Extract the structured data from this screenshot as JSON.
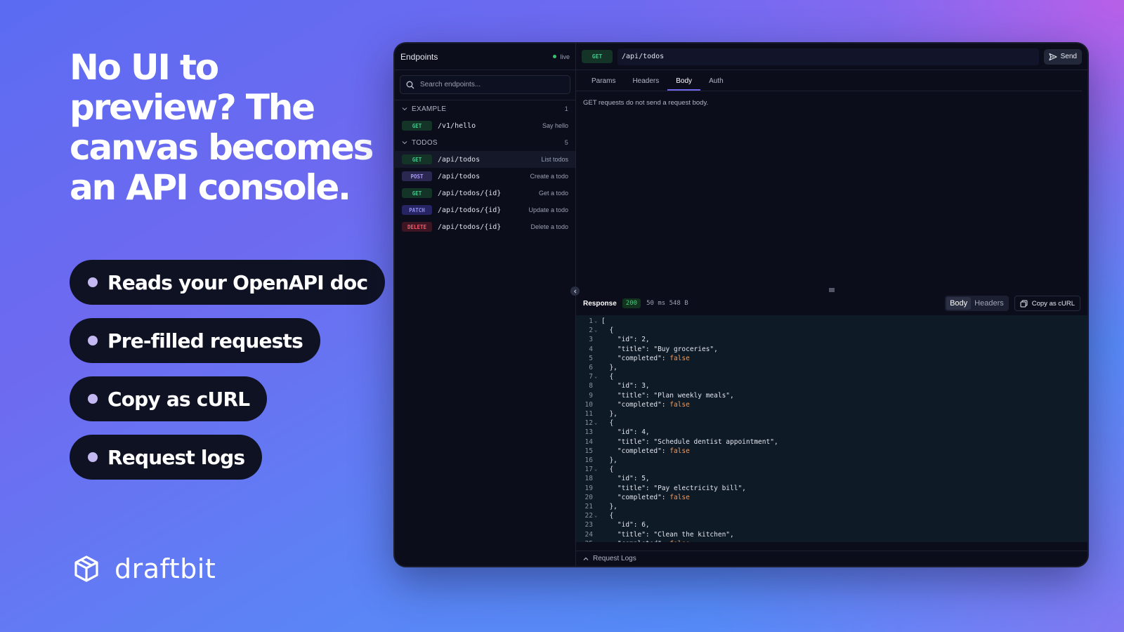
{
  "promo": {
    "headline": "No UI to preview? The canvas becomes an API console.",
    "features": [
      "Reads your OpenAPI doc",
      "Pre-filled requests",
      "Copy as cURL",
      "Request logs"
    ],
    "brand": "draftbit"
  },
  "sidebar": {
    "title": "Endpoints",
    "status": "live",
    "search_placeholder": "Search endpoints...",
    "groups": [
      {
        "name": "EXAMPLE",
        "count": "1",
        "endpoints": [
          {
            "method": "GET",
            "path": "/v1/hello",
            "desc": "Say hello"
          }
        ]
      },
      {
        "name": "TODOS",
        "count": "5",
        "endpoints": [
          {
            "method": "GET",
            "path": "/api/todos",
            "desc": "List todos"
          },
          {
            "method": "POST",
            "path": "/api/todos",
            "desc": "Create a todo"
          },
          {
            "method": "GET",
            "path": "/api/todos/{id}",
            "desc": "Get a todo"
          },
          {
            "method": "PATCH",
            "path": "/api/todos/{id}",
            "desc": "Update a todo"
          },
          {
            "method": "DELETE",
            "path": "/api/todos/{id}",
            "desc": "Delete a todo"
          }
        ]
      }
    ]
  },
  "request": {
    "method": "GET",
    "url": "/api/todos",
    "send_label": "Send",
    "tabs": [
      "Params",
      "Headers",
      "Body",
      "Auth"
    ],
    "active_tab": "Body",
    "body_note": "GET requests do not send a request body."
  },
  "response": {
    "title": "Response",
    "status": "200",
    "meta": "50 ms  548 B",
    "view_tabs": [
      "Body",
      "Headers"
    ],
    "copy_label": "Copy as cURL",
    "lines": [
      "[",
      "  {",
      "    \"id\": 2,",
      "    \"title\": \"Buy groceries\",",
      "    \"completed\": false",
      "  },",
      "  {",
      "    \"id\": 3,",
      "    \"title\": \"Plan weekly meals\",",
      "    \"completed\": false",
      "  },",
      "  {",
      "    \"id\": 4,",
      "    \"title\": \"Schedule dentist appointment\",",
      "    \"completed\": false",
      "  },",
      "  {",
      "    \"id\": 5,",
      "    \"title\": \"Pay electricity bill\",",
      "    \"completed\": false",
      "  },",
      "  {",
      "    \"id\": 6,",
      "    \"title\": \"Clean the kitchen\",",
      "    \"completed\": false"
    ],
    "foldable_lines": [
      1,
      2,
      7,
      12,
      17,
      22
    ]
  },
  "logs_label": "Request Logs",
  "colors": {
    "accent": "#6f66ea",
    "get": "#47c48a",
    "post": "#a59af0",
    "patch": "#8f8df3",
    "delete": "#f05a6c",
    "false_literal": "#f39a5b"
  }
}
